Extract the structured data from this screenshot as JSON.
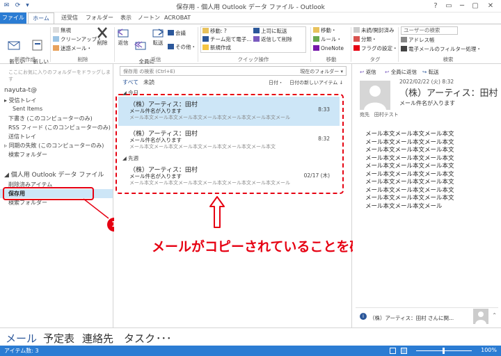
{
  "window": {
    "title": "保存用 - 個人用 Outlook データ ファイル - Outlook",
    "controls": [
      "?",
      "▭",
      "─",
      "▢",
      "✕"
    ]
  },
  "tabs": [
    "ファイル",
    "ホーム",
    "送受信",
    "フォルダー",
    "表示",
    "ノートン",
    "ACROBAT"
  ],
  "ribbon": {
    "new": {
      "new_mail": "新しい\n電子メール",
      "new_items": "新しい\nアイテム",
      "label": "新規作成"
    },
    "delete": {
      "ignore": "無視",
      "cleanup": "クリーンアップ・",
      "junk": "迷惑メール・",
      "delete": "削除",
      "label": "削除"
    },
    "respond": {
      "reply": "返信",
      "reply_all": "全員に\n返信",
      "forward": "転送",
      "meeting": "会議",
      "more": "その他・",
      "label": "返信"
    },
    "quicksteps": {
      "items": [
        "移動: ?",
        "チーム宛て電子...",
        "新規作成",
        "上司に転送",
        "返信して削除"
      ],
      "label": "クイック操作"
    },
    "move": {
      "move": "移動・",
      "rules": "ルール・",
      "onenote": "OneNote",
      "label": "移動"
    },
    "tags": {
      "unread": "未読/開封済み",
      "categorize": "分類・",
      "followup": "フラグの設定・",
      "label": "タグ"
    },
    "find": {
      "search_people": "ユーザーの検索",
      "address_book": "アドレス帳",
      "filter": "電子メールのフィルター処理・",
      "label": "検索"
    }
  },
  "folder_pane": {
    "favorites_hint": "ここにお気に入りのフォルダーをドラッグします",
    "account": "nayuta-t@",
    "account_folders": [
      "受信トレイ",
      "Sent Items",
      "下書き (このコンピューターのみ)",
      "RSS フィード (このコンピューターのみ)",
      "送信トレイ",
      "同期の失敗 (このコンピューターのみ)",
      "検索フォルダー"
    ],
    "pst_name": "個人用 Outlook データ ファイル",
    "pst_folders": [
      "削除済みアイテム",
      "保存用",
      "検索フォルダー"
    ]
  },
  "message_list": {
    "search_placeholder": "保存用 の検索 (Ctrl+E)",
    "search_scope": "現在のフォルダー",
    "filter_all": "すべて",
    "filter_unread": "未読",
    "sort_by": "日付・",
    "sort_order": "日付の新しいアイテム ↓",
    "groups": [
      {
        "header": "今日",
        "messages": [
          {
            "from": "（株）アーティス：田村",
            "subject": "メール件名が入ります",
            "preview": "メール本文メール本文メール本文メール本文メール本文メール本文メール",
            "time": "8:33"
          },
          {
            "from": "（株）アーティス：田村",
            "subject": "メール件名が入ります",
            "preview": "メール本文メール本文メール本文メール本文メール本文メール本文",
            "time": "8:32"
          }
        ]
      },
      {
        "header": "先週",
        "messages": [
          {
            "from": "（株）アーティス：田村",
            "subject": "メール件名が入ります",
            "preview": "メール本文メール本文メール本文メール本文メール本文メール本文メール",
            "time": "02/17 (木)"
          }
        ]
      }
    ]
  },
  "reading_pane": {
    "actions": [
      "返信",
      "全員に返信",
      "転送"
    ],
    "date": "2022/02/22 (火) 8:32",
    "from": "（株）アーティス：田村",
    "subject": "メール件名が入ります",
    "to_label": "宛先",
    "to": "田村テスト",
    "body_lines": [
      "メール本文メール本文メール本文",
      "メール本文メール本文メール本文",
      "メール本文メール本文メール本文",
      "メール本文メール本文メール本文",
      "メール本文メール本文メール本文",
      "メール本文メール本文メール本文",
      "メール本文メール本文メール本文",
      "メール本文メール本文メール本文",
      "メール本文メール本文メール本文",
      "メール本文メール本文メール"
    ],
    "people_text": "（株）アーティス：田村 さんに関..."
  },
  "annotation": {
    "badge": "1",
    "callout": "メールがコピーされていることを確認"
  },
  "nav": [
    "メール",
    "予定表",
    "連絡先",
    "タスク",
    "･･･"
  ],
  "status": {
    "items": "アイテム数: 3",
    "zoom": "100%"
  },
  "colors": {
    "accent": "#2b7cd3",
    "selection": "#cde6f7",
    "annotation": "#e60012"
  }
}
